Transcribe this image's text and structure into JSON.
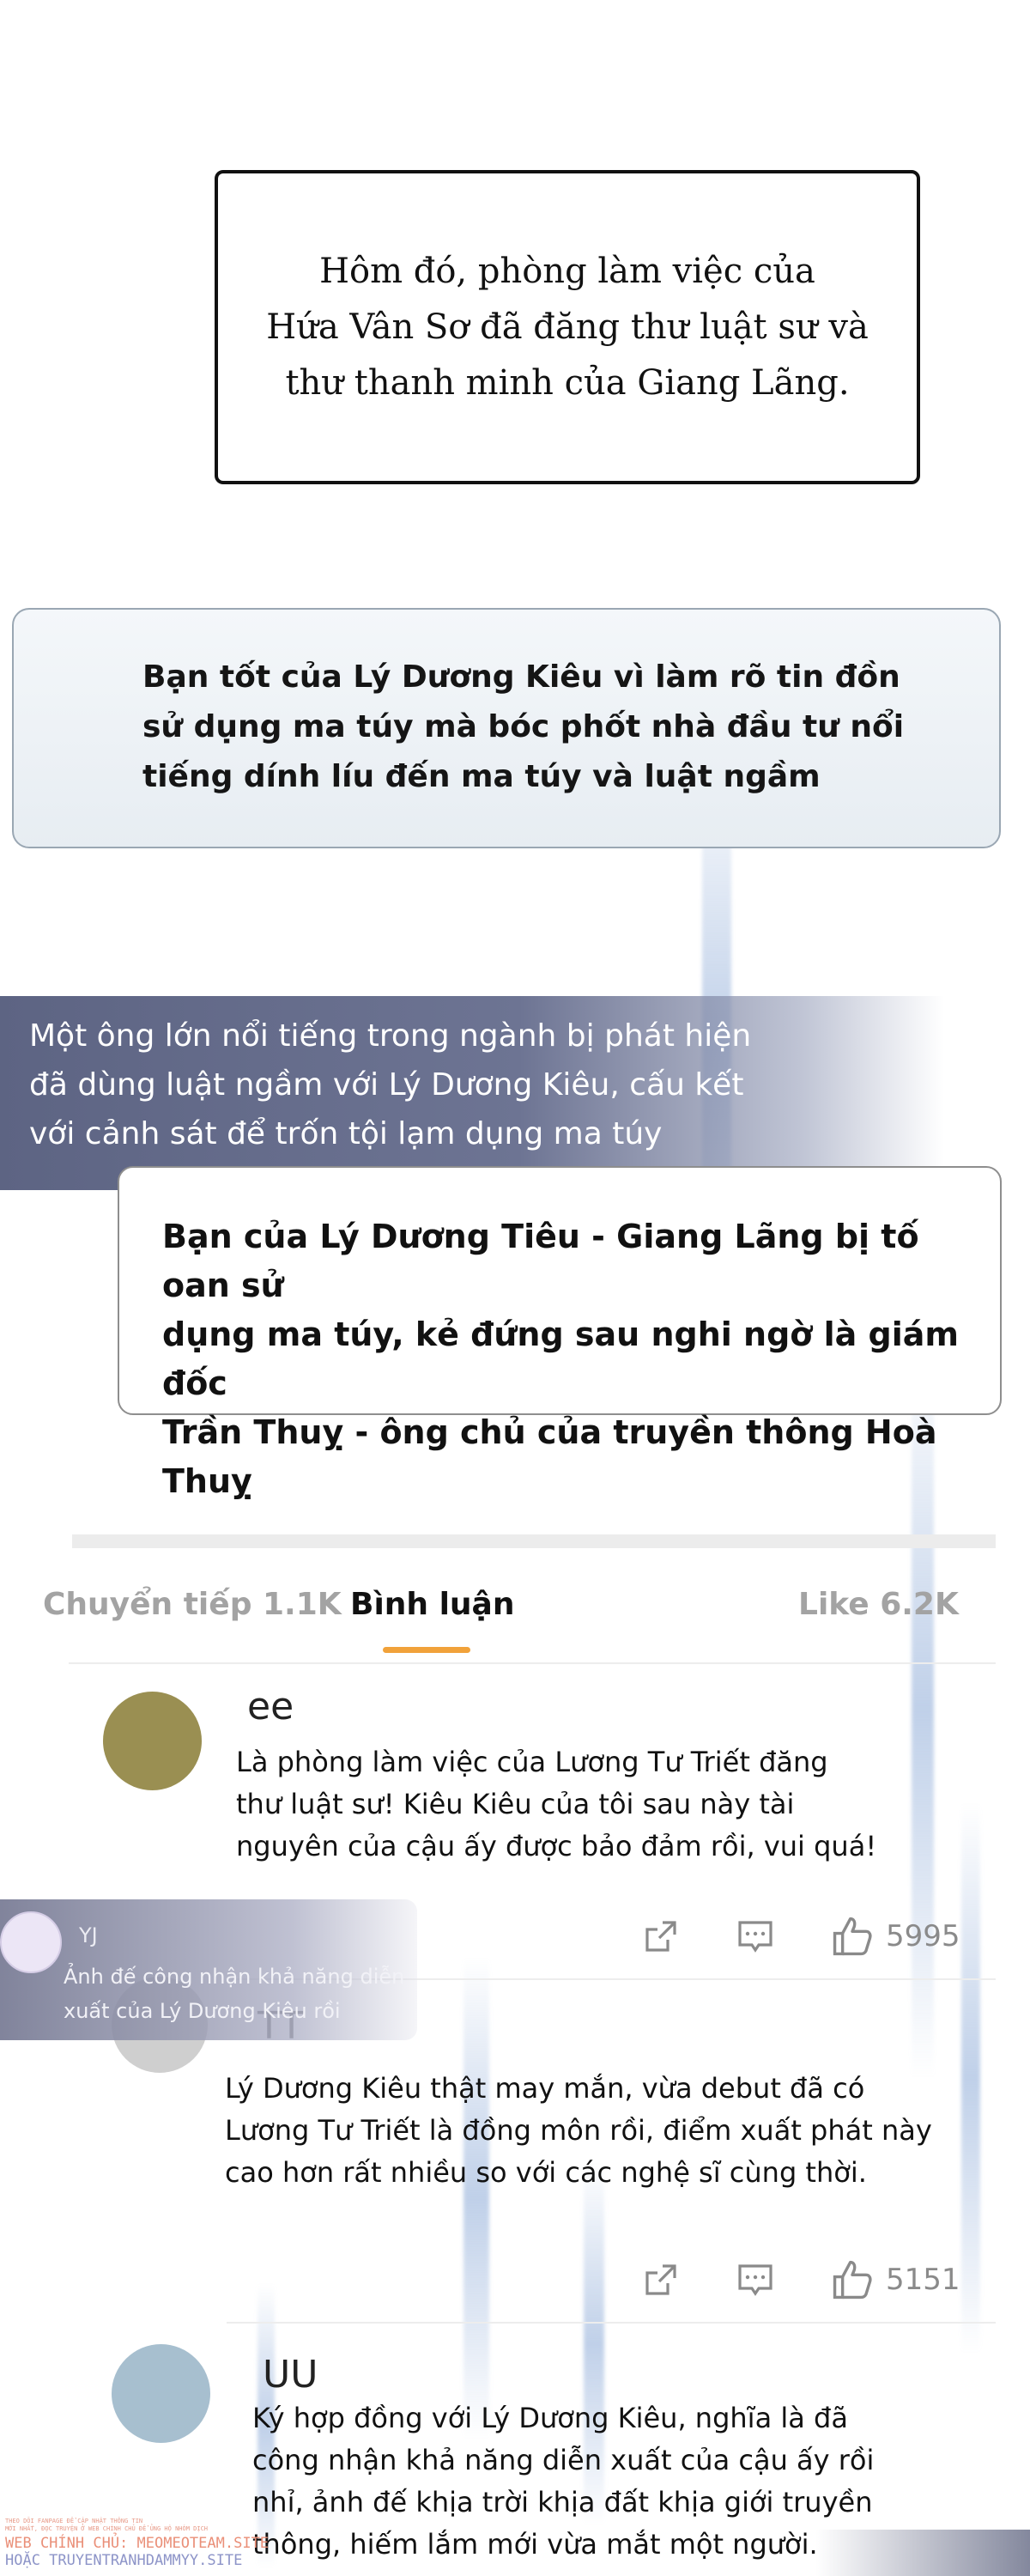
{
  "narration": {
    "lines": [
      "Hôm đó, phòng làm việc của",
      "Hứa Vân Sơ đã đăng thư luật sư và",
      "thư thanh minh của Giang Lãng."
    ]
  },
  "news_box_1": {
    "lines": [
      "Bạn tốt của Lý Dương Kiêu vì làm rõ tin đồn",
      "sử dụng ma túy mà bóc phốt nhà đầu tư nổi",
      "tiếng dính líu đến ma túy và luật ngầm"
    ]
  },
  "news_banner": {
    "lines": [
      "Một ông lớn nổi tiếng trong ngành bị phát hiện",
      "đã dùng luật ngầm với Lý Dương Kiêu, cấu kết",
      "với cảnh sát để trốn tội lạm dụng ma túy"
    ]
  },
  "news_box_2": {
    "lines": [
      "Bạn của Lý Dương Tiêu - Giang Lãng bị tố oan sử",
      "dụng ma túy, kẻ đứng sau nghi ngờ là giám đốc",
      "Trần Thuỵ - ông chủ của truyền thông Hoà Thuỵ"
    ]
  },
  "tabs": {
    "forward": "Chuyển tiếp 1.1K",
    "comments": "Bình luận",
    "like": "Like 6.2K"
  },
  "comments": [
    {
      "user": "ee",
      "avatar_color": "#9a8f52",
      "lines": [
        "Là phòng làm việc của Lương Tư Triết đăng",
        "thư luật sư! Kiêu Kiêu của tôi sau này tài",
        "nguyên của cậu ấy được bảo đảm rồi, vui quá!"
      ],
      "likes": "5995"
    },
    {
      "user": "TT",
      "avatar_color": "#cfcfcf",
      "lines": [
        "Lý Dương Kiêu thật may mắn, vừa debut đã có",
        "Lương Tư Triết là đồng môn rồi, điểm xuất phát này",
        "cao hơn rất nhiều so với các nghệ sĩ cùng thời."
      ],
      "likes": "5151"
    },
    {
      "user": "UU",
      "avatar_color": "#a7bfcf",
      "lines": [
        "Ký hợp đồng với Lý Dương Kiêu, nghĩa là đã",
        "công nhận khả năng diễn xuất của cậu ấy rồi",
        "nhỉ, ảnh đế khịa trời khịa đất khịa giới truyền",
        "thông, hiếm lắm mới vừa mắt một người."
      ]
    }
  ],
  "notification": {
    "user": "YJ",
    "lines": [
      "Ảnh đế công nhận khả năng diễn",
      "xuất của Lý Dương Kiêu rồi"
    ]
  },
  "watermark": {
    "small_1": "THEO DÕI FANPAGE ĐỂ CẬP NHẬT THÔNG TIN",
    "small_2": "MỚI NHẤT, ĐỌC TRUYỆN Ở WEB CHÍNH CHỦ ĐỂ ỦNG HỘ NHÓM DỊCH",
    "main": "WEB CHÍNH CHỦ: MEOMEOTEAM.SITE",
    "site": "HOẶC TRUYENTRANHDAMMYY.SITE"
  },
  "colors": {
    "tab_underline": "#f1a23a",
    "banner": "#5d6483"
  }
}
